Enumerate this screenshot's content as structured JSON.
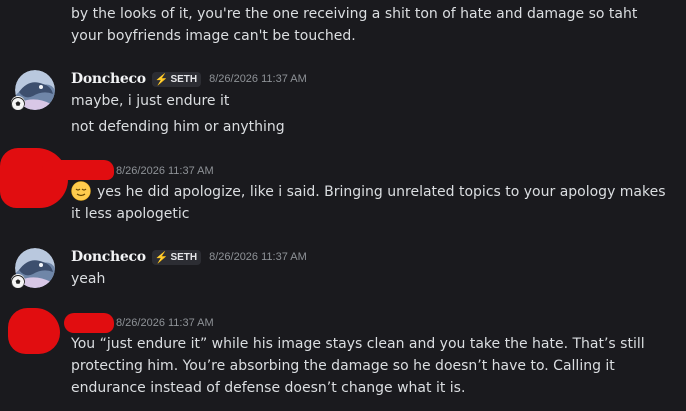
{
  "messages": {
    "m0": {
      "lines": [
        "by the looks of it, you're the one receiving a shit ton of hate and damage so taht",
        "your boyfriends image can't be touched."
      ]
    },
    "m1": {
      "username": "Doncheco",
      "tag_icon": "lightning-bolt-icon",
      "tag": "SETH",
      "time": "8/26/2026 11:37 AM",
      "lines": [
        "maybe, i just endure it",
        "not defending him or anything"
      ]
    },
    "m2": {
      "time": "8/26/2026 11:37 AM",
      "emoji": "relieved-face-emoji",
      "lines": [
        "yes he did apologize, like i said. Bringing unrelated topics to your apology makes",
        "it less apologetic"
      ]
    },
    "m3": {
      "username": "Doncheco",
      "tag_icon": "lightning-bolt-icon",
      "tag": "SETH",
      "time": "8/26/2026 11:37 AM",
      "lines": [
        "yeah"
      ]
    },
    "m4": {
      "time": "8/26/2026 11:37 AM",
      "lines": [
        "You “just endure it” while his image stays clean and you take the hate. That’s still",
        "protecting him. You’re absorbing the damage so he doesn’t have to. Calling it",
        "endurance instead of defense doesn’t change what it is."
      ]
    }
  },
  "colors": {
    "background": "#1a1a1e",
    "text": "#dbdee1",
    "timestamp": "#8e9297",
    "redaction": "#e10d10",
    "tag_bolt": "#7aa6ff"
  }
}
